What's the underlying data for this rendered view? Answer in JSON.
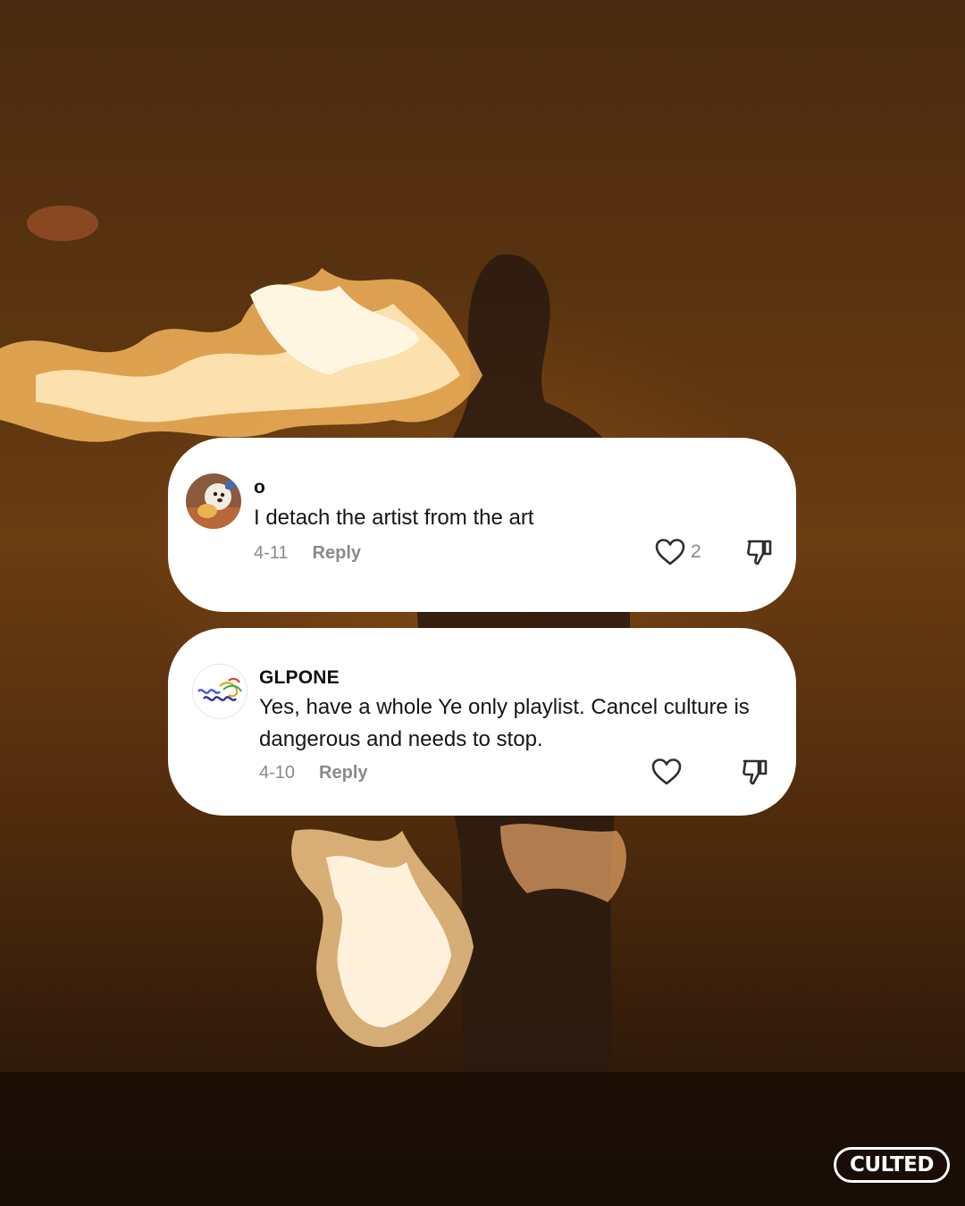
{
  "comments": [
    {
      "username": "o",
      "text": "I detach the artist from the art",
      "date": "4-11",
      "reply_label": "Reply",
      "like_count": "2",
      "avatar_icon": "dog-photo-avatar"
    },
    {
      "username": "GLPONE",
      "text": "Yes, have a whole Ye only playlist. Cancel culture is dangerous and needs to stop.",
      "date": "4-10",
      "reply_label": "Reply",
      "like_count": "",
      "avatar_icon": "protein-ribbon-avatar"
    }
  ],
  "brand": {
    "logo_text": "CULTED"
  },
  "colors": {
    "card_bg": "#ffffff",
    "meta_text": "#8a8a8a",
    "primary_text": "#161616"
  }
}
